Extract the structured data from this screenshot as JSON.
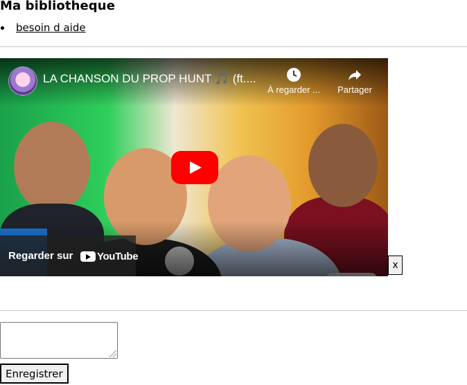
{
  "page": {
    "title": "Ma bibliotheque"
  },
  "help": {
    "link_label": "besoin d aide"
  },
  "video": {
    "title": "LA CHANSON DU PROP HUNT 🎵 (ft....",
    "watch_later_label": "À regarder ...",
    "share_label": "Partager",
    "watch_on_label": "Regarder sur",
    "youtube_label": "YouTube",
    "accent_color": "#ff0000"
  },
  "close_button": {
    "label": "x"
  },
  "note_field": {
    "value": "",
    "placeholder": ""
  },
  "save_button": {
    "label": "Enregistrer"
  }
}
